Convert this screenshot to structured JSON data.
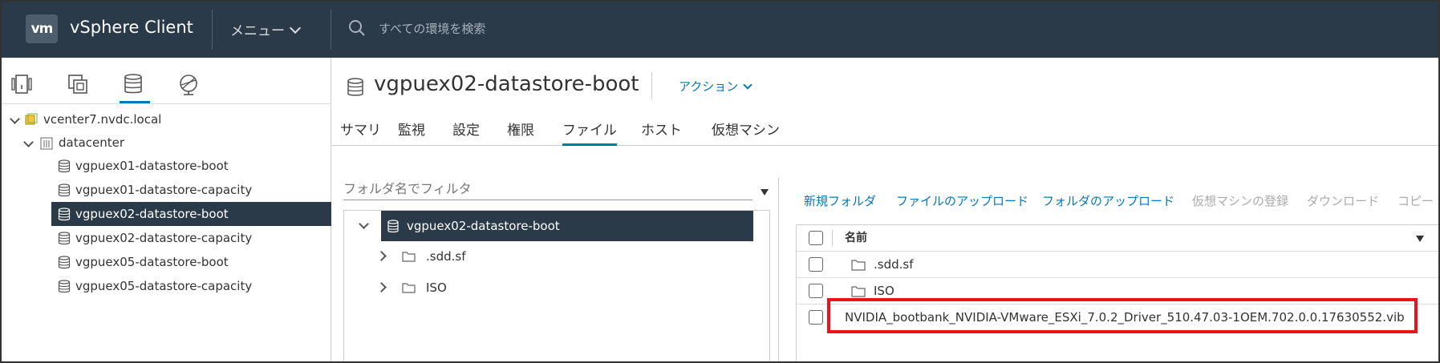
{
  "header": {
    "logo": "vm",
    "app_title": "vSphere Client",
    "menu_label": "メニュー",
    "search_placeholder": "すべての環境を検索"
  },
  "sidebar": {
    "icons": [
      "hosts-clusters-icon",
      "vms-templates-icon",
      "storage-icon",
      "networking-icon"
    ],
    "active_icon": "storage-icon",
    "tree": {
      "vcenter": "vcenter7.nvdc.local",
      "datacenter": "datacenter",
      "datastores": [
        "vgpuex01-datastore-boot",
        "vgpuex01-datastore-capacity",
        "vgpuex02-datastore-boot",
        "vgpuex02-datastore-capacity",
        "vgpuex05-datastore-boot",
        "vgpuex05-datastore-capacity"
      ],
      "selected": "vgpuex02-datastore-boot"
    }
  },
  "main": {
    "title": "vgpuex02-datastore-boot",
    "actions_label": "アクション",
    "tabs": [
      "サマリ",
      "監視",
      "設定",
      "権限",
      "ファイル",
      "ホスト",
      "仮想マシン"
    ],
    "active_tab": "ファイル",
    "folder_filter_placeholder": "フォルダ名でフィルタ",
    "folder_tree": {
      "root": "vgpuex02-datastore-boot",
      "children": [
        ".sdd.sf",
        "ISO"
      ]
    },
    "toolbar": {
      "new_folder": "新規フォルダ",
      "upload_files": "ファイルのアップロード",
      "upload_folder": "フォルダのアップロード",
      "register_vm": "仮想マシンの登録",
      "download": "ダウンロード",
      "copy": "コピー"
    },
    "file_grid": {
      "column_name": "名前",
      "rows": [
        {
          "type": "folder",
          "name": ".sdd.sf"
        },
        {
          "type": "folder",
          "name": "ISO"
        },
        {
          "type": "file",
          "name": "NVIDIA_bootbank_NVIDIA-VMware_ESXi_7.0.2_Driver_510.47.03-1OEM.702.0.0.17630552.vib"
        }
      ]
    }
  },
  "colors": {
    "header_bg": "#2b3a48",
    "accent": "#0079b8",
    "selection_bg": "#2b3a48",
    "highlight_border": "#e8141c"
  }
}
